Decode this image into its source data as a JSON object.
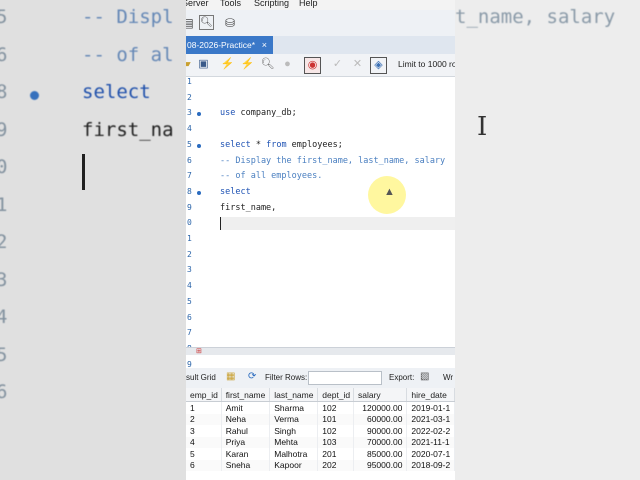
{
  "background": {
    "left_lines": [
      {
        "num": "5",
        "text": "-- Displ",
        "kind": "comment"
      },
      {
        "num": "6",
        "text": "-- of al",
        "kind": "comment"
      },
      {
        "num": "8",
        "text": "select",
        "kind": "keyword",
        "dot": true
      },
      {
        "num": "9",
        "text": "first_na",
        "kind": "plain"
      },
      {
        "num": "0",
        "text": "",
        "kind": "caret"
      },
      {
        "num": "1",
        "text": "",
        "kind": "plain"
      },
      {
        "num": "2",
        "text": "",
        "kind": "plain"
      },
      {
        "num": "3",
        "text": "",
        "kind": "plain"
      },
      {
        "num": "4",
        "text": "",
        "kind": "plain"
      },
      {
        "num": "5",
        "text": "",
        "kind": "plain"
      },
      {
        "num": "6",
        "text": "",
        "kind": "plain"
      }
    ],
    "right_text": "t_name, salary"
  },
  "menubar": {
    "items": [
      "Server",
      "Tools",
      "Scripting",
      "Help"
    ]
  },
  "tab": {
    "label": "08-2026-Practice*",
    "close": "×"
  },
  "toolbar2": {
    "limit_label": "Limit to 1000 rov"
  },
  "editor": {
    "lines": [
      {
        "num": "1",
        "text": "",
        "kind": "plain"
      },
      {
        "num": "2",
        "text": "",
        "kind": "plain"
      },
      {
        "num": "3",
        "text": "use company_db;",
        "kind": "use",
        "dot": true
      },
      {
        "num": "4",
        "text": "",
        "kind": "plain"
      },
      {
        "num": "5",
        "text": "select * from employees;",
        "kind": "select",
        "dot": true
      },
      {
        "num": "6",
        "text": "-- Display the first_name, last_name, salary",
        "kind": "comment"
      },
      {
        "num": "7",
        "text": "-- of all employees.",
        "kind": "comment"
      },
      {
        "num": "8",
        "text": "select",
        "kind": "keyword",
        "dot": true
      },
      {
        "num": "9",
        "text": "first_name,",
        "kind": "plain"
      },
      {
        "num": "0",
        "text": "",
        "kind": "current"
      },
      {
        "num": "1",
        "text": "",
        "kind": "plain"
      },
      {
        "num": "2",
        "text": "",
        "kind": "plain"
      },
      {
        "num": "3",
        "text": "",
        "kind": "plain"
      },
      {
        "num": "4",
        "text": "",
        "kind": "plain"
      },
      {
        "num": "5",
        "text": "",
        "kind": "plain"
      },
      {
        "num": "6",
        "text": "",
        "kind": "plain"
      },
      {
        "num": "7",
        "text": "",
        "kind": "plain"
      },
      {
        "num": "8",
        "text": "",
        "kind": "plain"
      },
      {
        "num": "9",
        "text": "",
        "kind": "plain"
      }
    ]
  },
  "results": {
    "grid_label": "sult Grid",
    "filter_label": "Filter Rows:",
    "export_label": "Export:",
    "wrap_label": "Wr",
    "columns": [
      "emp_id",
      "first_name",
      "last_name",
      "dept_id",
      "salary",
      "hire_date"
    ],
    "rows": [
      [
        "1",
        "Amit",
        "Sharma",
        "102",
        "120000.00",
        "2019-01-1"
      ],
      [
        "2",
        "Neha",
        "Verma",
        "101",
        "60000.00",
        "2021-03-1"
      ],
      [
        "3",
        "Rahul",
        "Singh",
        "102",
        "90000.00",
        "2022-02-2"
      ],
      [
        "4",
        "Priya",
        "Mehta",
        "103",
        "70000.00",
        "2021-11-1"
      ],
      [
        "5",
        "Karan",
        "Malhotra",
        "201",
        "85000.00",
        "2020-07-1"
      ],
      [
        "6",
        "Sneha",
        "Kapoor",
        "202",
        "95000.00",
        "2018-09-2"
      ]
    ]
  },
  "colors": {
    "keyword": "#1f53b4",
    "comment": "#4a7fc0",
    "tab_active": "#3a78c8",
    "highlight": "#fff050"
  }
}
